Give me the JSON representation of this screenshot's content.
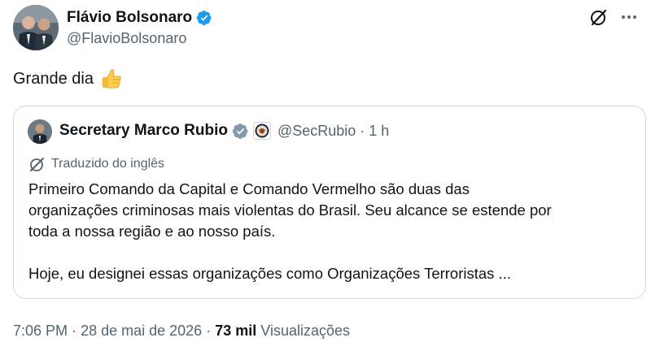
{
  "author": {
    "display_name": "Flávio Bolsonaro",
    "handle": "@FlavioBolsonaro"
  },
  "tweet": {
    "text": "Grande dia",
    "emoji": "thumbs-up-icon"
  },
  "quoted": {
    "display_name": "Secretary Marco Rubio",
    "handle": "@SecRubio",
    "separator": "·",
    "time": "1 h",
    "translated_label": "Traduzido do inglês",
    "paragraph1_lines": [
      "Primeiro Comando da Capital e Comando Vermelho são duas das",
      "organizações criminosas mais violentas do Brasil. Seu alcance se estende por",
      "toda a nossa região e ao nosso país."
    ],
    "paragraph2": "Hoje, eu designei essas organizações como Organizações Terroristas ..."
  },
  "meta": {
    "time": "7:06 PM",
    "dot1": "·",
    "date": "28 de mai de 2026",
    "dot2": "·",
    "views_count": "73 mil",
    "views_label": "Visualizações"
  },
  "colors": {
    "text_primary": "#0f1419",
    "text_secondary": "#536471",
    "verified_blue": "#1d9bf0",
    "verified_gray": "#829aab",
    "border": "#cfd9de"
  }
}
